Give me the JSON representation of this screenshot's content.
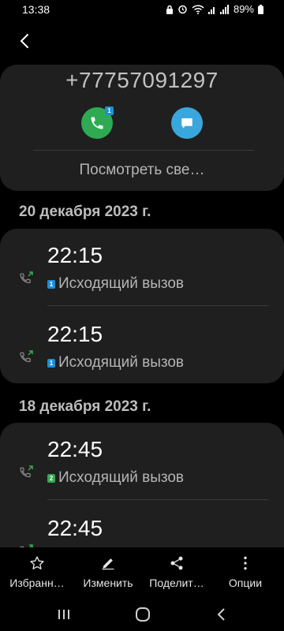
{
  "status": {
    "time": "13:38",
    "battery": "89%"
  },
  "contact": {
    "number": "+77757091297",
    "sim_badge": "1",
    "view_details": "Посмотреть све…"
  },
  "groups": [
    {
      "date": "20 декабря 2023 г.",
      "calls": [
        {
          "time": "22:15",
          "type": "Исходящий вызов",
          "sim": "1"
        },
        {
          "time": "22:15",
          "type": "Исходящий вызов",
          "sim": "1"
        }
      ]
    },
    {
      "date": "18 декабря 2023 г.",
      "calls": [
        {
          "time": "22:45",
          "type": "Исходящий вызов",
          "sim": "2"
        },
        {
          "time": "22:45",
          "type": "",
          "sim": ""
        }
      ]
    }
  ],
  "bottom_bar": {
    "favorites": "Избранн…",
    "edit": "Изменить",
    "share": "Поделит…",
    "options": "Опции"
  },
  "icons": {
    "call_button": "phone-icon",
    "message_button": "message-icon",
    "outgoing": "outgoing-call-icon"
  },
  "colors": {
    "call_green": "#2eaa52",
    "message_blue": "#3aa7dc",
    "sim1": "#1f8ed6",
    "sim2": "#35a853",
    "card_bg": "#1f1f1f"
  }
}
